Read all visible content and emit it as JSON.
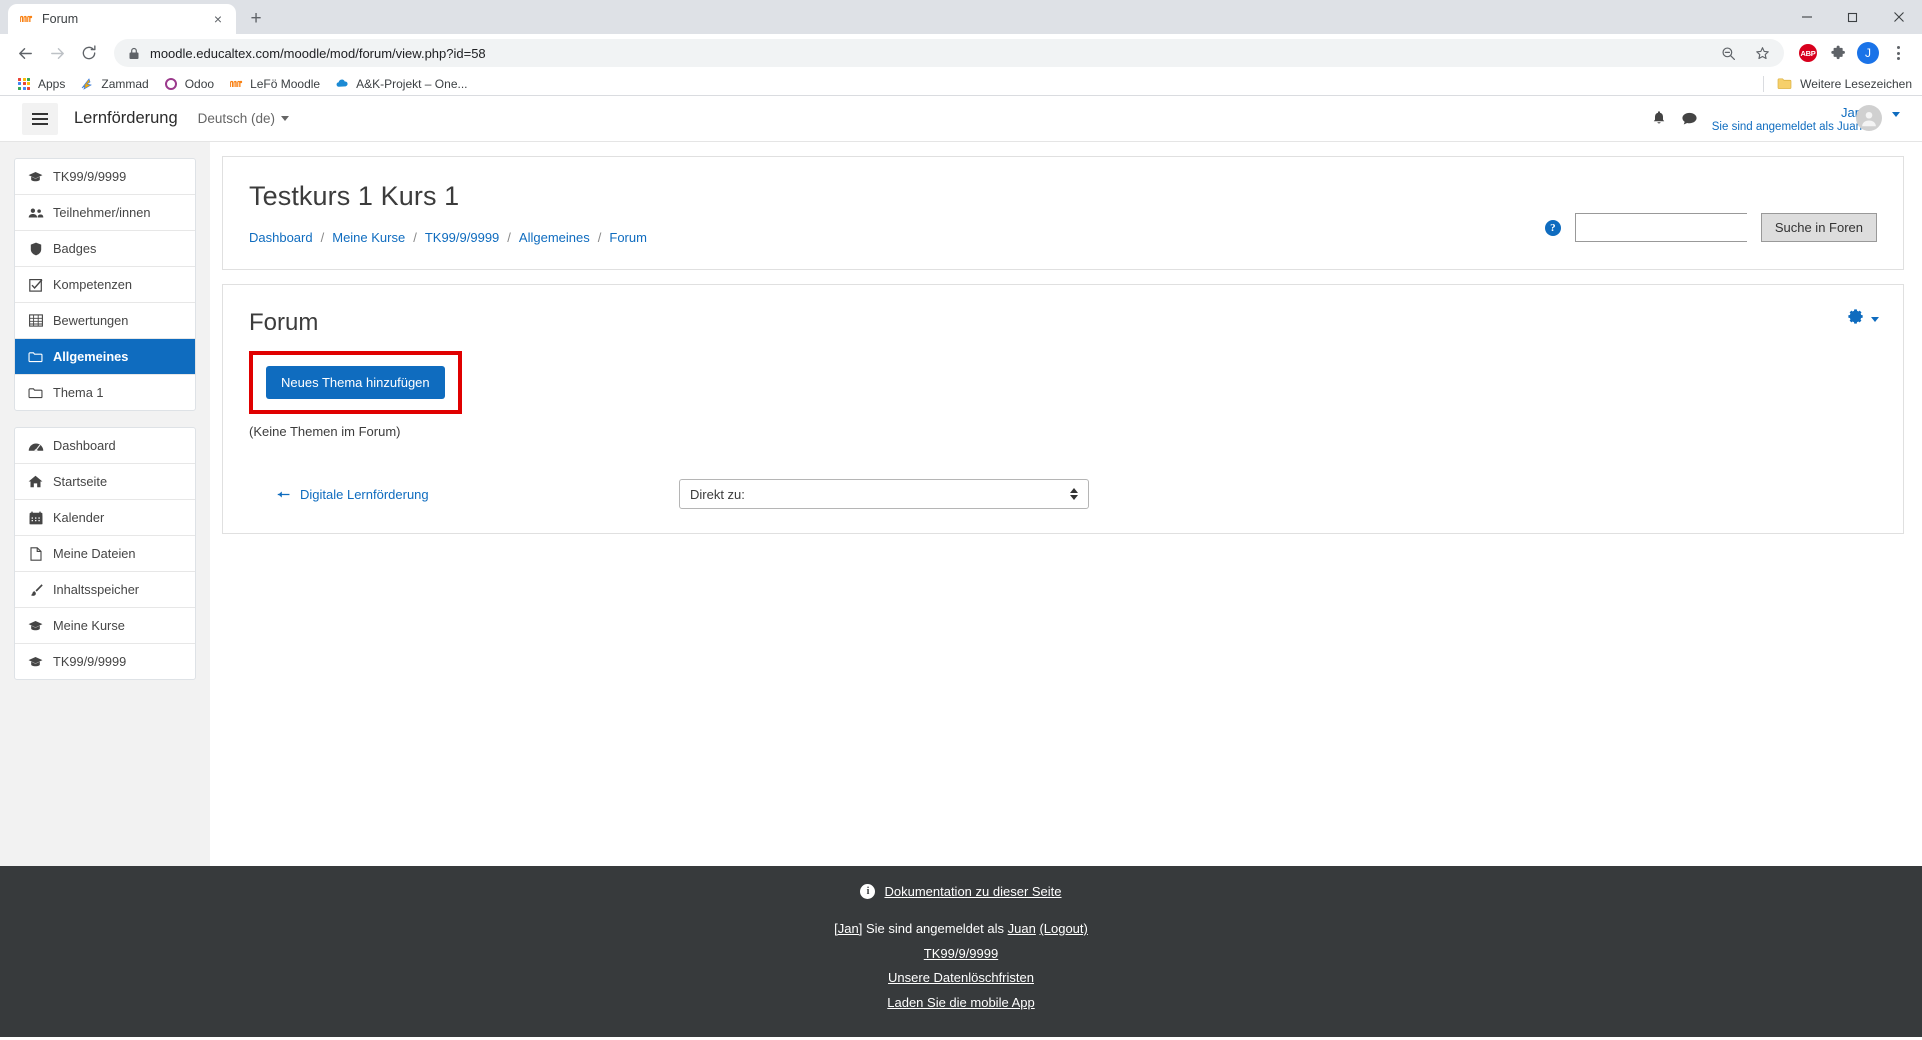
{
  "browser": {
    "tab": {
      "title": "Forum",
      "favicon": "moodle-icon",
      "close": "×"
    },
    "new_tab_label": "+",
    "window_controls": {
      "minimize": "minimize-icon",
      "maximize": "maximize-icon",
      "close": "close-icon"
    },
    "nav": {
      "back": "back-arrow-icon",
      "forward": "forward-arrow-icon",
      "reload": "reload-icon"
    },
    "url": "moodle.educaltex.com/moodle/mod/forum/view.php?id=58",
    "url_host": "moodle.educaltex.com",
    "url_path": "/moodle/mod/forum/view.php?id=58",
    "omnibox_icons": [
      "zoom-out-icon",
      "bookmark-star-icon"
    ],
    "extensions": [
      {
        "name": "adblock-plus",
        "label": "ABP"
      },
      {
        "name": "extensions-puzzle",
        "label": ""
      }
    ],
    "profile_initial": "J",
    "bookmarks": [
      {
        "label": "Apps",
        "icon": "apps-grid-icon"
      },
      {
        "label": "Zammad",
        "icon": "zammad-icon"
      },
      {
        "label": "Odoo",
        "icon": "odoo-icon"
      },
      {
        "label": "LeFö Moodle",
        "icon": "moodle-icon"
      },
      {
        "label": "A&K-Projekt – One...",
        "icon": "onedrive-cloud-icon"
      }
    ],
    "bookmarks_overflow": {
      "label": "Weitere Lesezeichen",
      "icon": "folder-icon"
    }
  },
  "header": {
    "menu_toggle": "hamburger-icon",
    "site_name": "Lernförderung",
    "language": "Deutsch (de)",
    "notifications_icon": "bell-icon",
    "messages_icon": "message-bubble-icon",
    "user_name": "Jan",
    "logged_in_as": "Sie sind angemeldet als Juan"
  },
  "sidebar": {
    "groups": [
      {
        "items": [
          {
            "label": "TK99/9/9999",
            "icon": "graduation-cap-icon",
            "active": false
          },
          {
            "label": "Teilnehmer/innen",
            "icon": "users-icon",
            "active": false
          },
          {
            "label": "Badges",
            "icon": "shield-icon",
            "active": false
          },
          {
            "label": "Kompetenzen",
            "icon": "checkbox-icon",
            "active": false
          },
          {
            "label": "Bewertungen",
            "icon": "table-icon",
            "active": false
          },
          {
            "label": "Allgemeines",
            "icon": "folder-icon",
            "active": true
          },
          {
            "label": "Thema 1",
            "icon": "folder-icon",
            "active": false
          }
        ]
      },
      {
        "items": [
          {
            "label": "Dashboard",
            "icon": "dashboard-icon",
            "active": false
          },
          {
            "label": "Startseite",
            "icon": "home-icon",
            "active": false
          },
          {
            "label": "Kalender",
            "icon": "calendar-icon",
            "active": false
          },
          {
            "label": "Meine Dateien",
            "icon": "file-icon",
            "active": false
          },
          {
            "label": "Inhaltsspeicher",
            "icon": "brush-icon",
            "active": false
          },
          {
            "label": "Meine Kurse",
            "icon": "graduation-cap-icon",
            "active": false
          },
          {
            "label": "TK99/9/9999",
            "icon": "graduation-cap-icon",
            "active": false
          }
        ]
      }
    ]
  },
  "main": {
    "course_title": "Testkurs 1 Kurs 1",
    "breadcrumb": [
      {
        "label": "Dashboard"
      },
      {
        "label": "Meine Kurse"
      },
      {
        "label": "TK99/9/9999"
      },
      {
        "label": "Allgemeines"
      },
      {
        "label": "Forum"
      }
    ],
    "breadcrumb_sep": "/",
    "search": {
      "help_icon": "help-circle-icon",
      "value": "",
      "placeholder": "",
      "button_label": "Suche in Foren"
    },
    "forum": {
      "title": "Forum",
      "settings_icon": "gear-icon",
      "add_topic_label": "Neues Thema hinzufügen",
      "empty_message": "(Keine Themen im Forum)",
      "highlight_color": "#e00000"
    },
    "bottom_nav": {
      "prev_icon": "arrow-left-icon",
      "prev_label": "Digitale Lernförderung",
      "jump_label": "Direkt zu:"
    }
  },
  "footer": {
    "doc_icon": "info-circle-icon",
    "doc_link": "Dokumentation zu dieser Seite",
    "login_prefix": "[Jan]",
    "login_mid": "Sie sind angemeldet als",
    "login_user": "Juan",
    "logout": "(Logout)",
    "links": [
      "TK99/9/9999",
      "Unsere Datenlöschfristen",
      "Laden Sie die mobile App"
    ]
  },
  "colors": {
    "brand_blue": "#0f6cbf",
    "highlight_red": "#e00000",
    "footer_bg": "#373a3c",
    "sidebar_bg": "#f2f2f2"
  }
}
